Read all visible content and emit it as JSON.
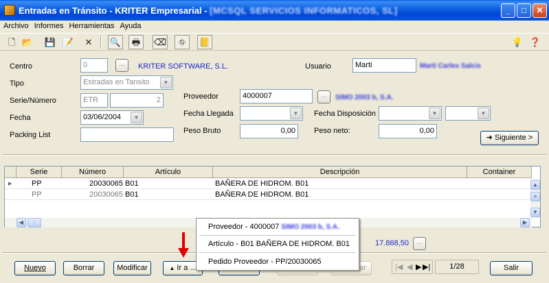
{
  "window": {
    "title": "Entradas en Tránsito - KRITER Empresarial - ",
    "title_blurred": "[MCSQL SERVICIOS INFORMATICOS, SL]",
    "min_label": "_",
    "max_label": "□",
    "close_label": "✕"
  },
  "menu": [
    "Archivo",
    "Informes",
    "Herramientas",
    "Ayuda"
  ],
  "toolbar": {
    "icons": [
      "new-icon",
      "open-icon",
      "save-icon",
      "edit-icon",
      "delete-icon",
      "preview-icon",
      "print-icon",
      "eraser-icon",
      "tree-icon",
      "notes-icon",
      "tip-icon",
      "help-icon"
    ],
    "glyphs": [
      "🗋",
      "📂",
      "💾",
      "📝",
      "✕",
      "🔍",
      "🖶",
      "⌫",
      "⛗",
      "📒",
      "💡",
      "❓"
    ]
  },
  "form": {
    "centro_label": "Centro",
    "centro_value": "0",
    "centro_name": "KRITER SOFTWARE, S.L.",
    "tipo_label": "Tipo",
    "tipo_value": "Estradas en Tansito",
    "serie_label": "Serie/Número",
    "serie_value": "ETR",
    "numero_value": "2",
    "fecha_label": "Fecha",
    "fecha_value": "03/06/2004",
    "packing_label": "Packing List",
    "packing_value": "",
    "usuario_label": "Usuario",
    "usuario_value": "Marti",
    "usuario_name_blurred": "Martí Carles Salcis",
    "proveedor_label": "Proveedor",
    "proveedor_value": "4000007",
    "proveedor_name_blurred": "SIMO 2003 b, S.A.",
    "fecha_llegada_label": "Fecha Llegada",
    "fecha_llegada_value": "",
    "fecha_disposicion_label": "Fecha Disposición",
    "fecha_disposicion_value": "",
    "peso_bruto_label": "Peso Bruto",
    "peso_bruto_value": "0,00",
    "peso_neto_label": "Peso neto:",
    "peso_neto_value": "0,00",
    "siguiente_label": "Siguiente >",
    "siguiente_glyph": "➜"
  },
  "grid": {
    "columns": [
      "Serie",
      "Número",
      "Artículo",
      "Descripción",
      "Container"
    ],
    "rows": [
      {
        "serie": "PP",
        "numero": "20030065",
        "articulo": "B01",
        "descripcion": "BAÑERA DE HIDROM. B01",
        "container": ""
      },
      {
        "serie": "PP",
        "numero": "20030065",
        "articulo": "B01",
        "descripcion": "BAÑERA DE HIDROM. B01",
        "container": ""
      }
    ]
  },
  "total": {
    "value": "17.868,50",
    "button": "..."
  },
  "popup": {
    "items": [
      {
        "label": "Proveedor - 4000007 ",
        "blurred": "SIMO 2003 b, S.A."
      },
      {
        "label": "Artículo - B01 BAÑERA DE HIDROM. B01"
      },
      {
        "label": "Pedido Proveedor - PP/20030065"
      }
    ]
  },
  "buttons": {
    "nuevo": "Nuevo",
    "borrar": "Borrar",
    "modificar": "Modificar",
    "ira": "Ir a ...",
    "ira_glyph": "▲",
    "buscar": "Buscar",
    "aceptar": "Aceptar",
    "cancelar": "Cancelar",
    "salir": "Salir"
  },
  "navigation": {
    "record": "1/28",
    "first": "|◀",
    "prev": "◀",
    "next": "▶",
    "last": "▶|"
  },
  "colors": {
    "titlebar": "#0b5fe2",
    "link": "#1e24c8",
    "arrow": "#e00000"
  }
}
